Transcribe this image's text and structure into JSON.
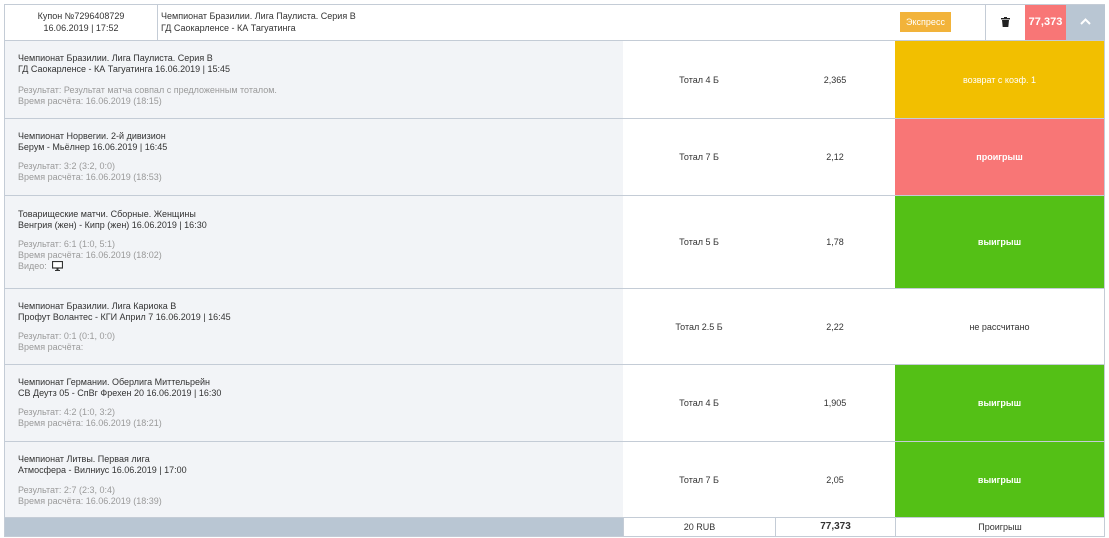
{
  "header": {
    "coupon_title": "Купон №7296408729",
    "coupon_date": "16.06.2019 | 17:52",
    "league": "Чемпионат Бразилии. Лига Паулиста. Серия В",
    "teams": "ГД Саокарленсе - КА Тагуатинга",
    "badge": "Экспресс",
    "total_odds": "77,373"
  },
  "bets": [
    {
      "league": "Чемпионат Бразилии. Лига Паулиста. Серия В",
      "match": "ГД Саокарленсе - КА Тагуатинга 16.06.2019 | 15:45",
      "result": "Результат: Результат матча совпал с предложенным тоталом.",
      "calc_time": "Время расчёта: 16.06.2019 (18:15)",
      "bet": "Тотал 4 Б",
      "odds": "2,365",
      "status": "возврат с коэф. 1"
    },
    {
      "league": "Чемпионат Норвегии. 2-й дивизион",
      "match": "Берум - Мьёлнер 16.06.2019 | 16:45",
      "result": "Результат: 3:2 (3:2, 0:0)",
      "calc_time": "Время расчёта: 16.06.2019 (18:53)",
      "bet": "Тотал 7 Б",
      "odds": "2,12",
      "status": "проигрыш"
    },
    {
      "league": "Товарищеские матчи. Сборные. Женщины",
      "match": "Венгрия (жен) - Кипр (жен) 16.06.2019 | 16:30",
      "result": "Результат: 6:1 (1:0, 5:1)",
      "calc_time": "Время расчёта: 16.06.2019 (18:02)",
      "video": "Видео:",
      "bet": "Тотал 5 Б",
      "odds": "1,78",
      "status": "выигрыш"
    },
    {
      "league": "Чемпионат Бразилии. Лига Кариока В",
      "match": "Профут Волантес - КГИ Април 7 16.06.2019 | 16:45",
      "result": "Результат: 0:1 (0:1, 0:0)",
      "calc_time": "Время расчёта:",
      "bet": "Тотал 2.5 Б",
      "odds": "2,22",
      "status": "не рассчитано"
    },
    {
      "league": "Чемпионат Германии. Оберлига Миттельрейн",
      "match": "СВ Деутз 05 - СпВг Фрехен 20 16.06.2019 | 16:30",
      "result": "Результат: 4:2 (1:0, 3:2)",
      "calc_time": "Время расчёта: 16.06.2019 (18:21)",
      "bet": "Тотал 4 Б",
      "odds": "1,905",
      "status": "выигрыш"
    },
    {
      "league": "Чемпионат Литвы. Первая лига",
      "match": "Атмосфера - Вилниус 16.06.2019 | 17:00",
      "result": "Результат: 2:7 (2:3, 0:4)",
      "calc_time": "Время расчёта: 16.06.2019 (18:39)",
      "bet": "Тотал 7 Б",
      "odds": "2,05",
      "status": "выигрыш"
    }
  ],
  "footer": {
    "stake": "20 RUB",
    "total_odds": "77,373",
    "result": "Проигрыш"
  },
  "icons": {
    "delete": "trash-icon",
    "collapse": "chevron-up-icon",
    "video": "monitor-icon"
  },
  "colors": {
    "refund": "#f2bf00",
    "lose": "#f87676",
    "win": "#54c016",
    "badge": "#f2b33a"
  }
}
